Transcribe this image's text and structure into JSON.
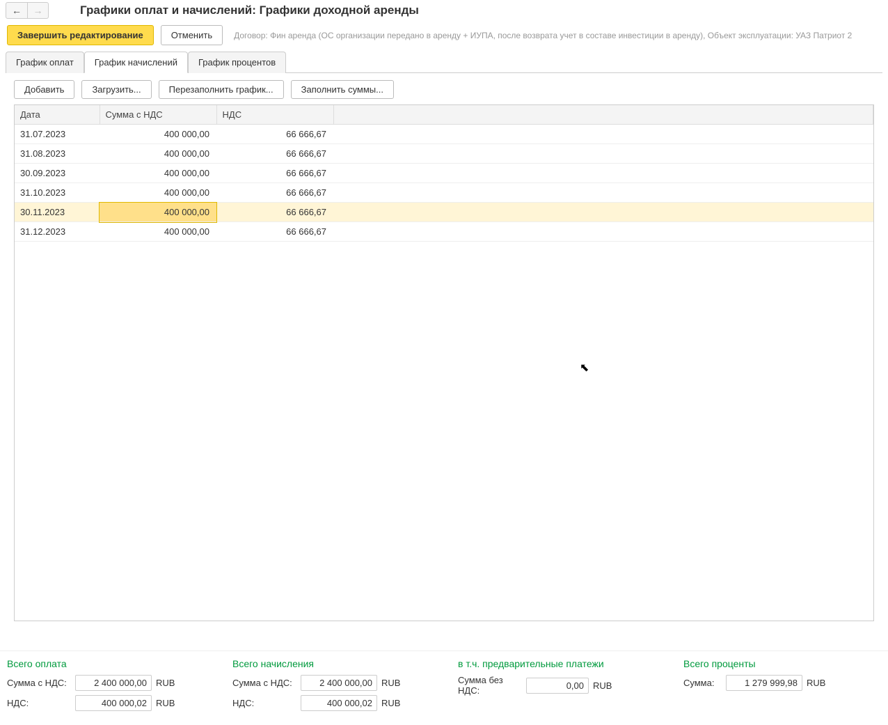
{
  "header": {
    "title": "Графики оплат и начислений: Графики доходной аренды"
  },
  "toolbar": {
    "finish_label": "Завершить редактирование",
    "cancel_label": "Отменить",
    "info": "Договор: Фин аренда (ОС организации передано в аренду + ИУПА, после возврата учет в составе инвестиции в аренду), Объект эксплуатации: УАЗ Патриот 2"
  },
  "tabs": {
    "payments": "График оплат",
    "accruals": "График начислений",
    "interest": "График процентов"
  },
  "tab_toolbar": {
    "add": "Добавить",
    "load": "Загрузить...",
    "refill": "Перезаполнить график...",
    "fill_sums": "Заполнить суммы..."
  },
  "table": {
    "headers": {
      "date": "Дата",
      "sum": "Сумма с НДС",
      "nds": "НДС"
    },
    "rows": [
      {
        "date": "31.07.2023",
        "sum": "400 000,00",
        "nds": "66 666,67"
      },
      {
        "date": "31.08.2023",
        "sum": "400 000,00",
        "nds": "66 666,67"
      },
      {
        "date": "30.09.2023",
        "sum": "400 000,00",
        "nds": "66 666,67"
      },
      {
        "date": "31.10.2023",
        "sum": "400 000,00",
        "nds": "66 666,67"
      },
      {
        "date": "30.11.2023",
        "sum": "400 000,00",
        "nds": "66 666,67"
      },
      {
        "date": "31.12.2023",
        "sum": "400 000,00",
        "nds": "66 666,67"
      }
    ],
    "selected_index": 4
  },
  "footer": {
    "currency": "RUB",
    "payment": {
      "title": "Всего оплата",
      "sum_label": "Сумма с НДС:",
      "sum": "2 400 000,00",
      "nds_label": "НДС:",
      "nds": "400 000,02"
    },
    "accrual": {
      "title": "Всего начисления",
      "sum_label": "Сумма с НДС:",
      "sum": "2 400 000,00",
      "nds_label": "НДС:",
      "nds": "400 000,02"
    },
    "prepay": {
      "title": "в т.ч. предварительные платежи",
      "sum_label": "Сумма без НДС:",
      "sum": "0,00"
    },
    "interest": {
      "title": "Всего проценты",
      "sum_label": "Сумма:",
      "sum": "1 279 999,98"
    }
  }
}
